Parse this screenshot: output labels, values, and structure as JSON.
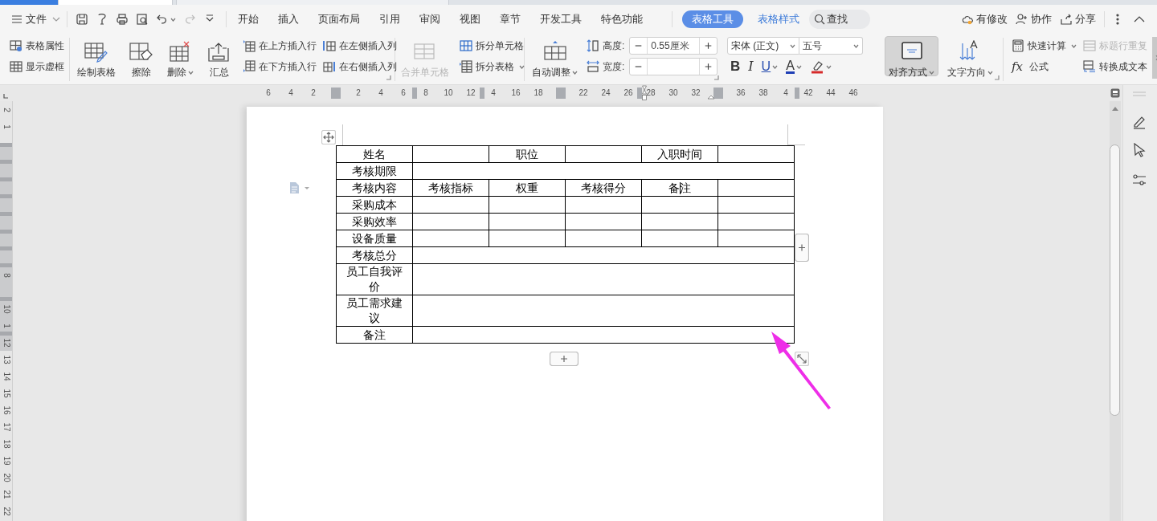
{
  "menu": {
    "file": "文件",
    "tabs": [
      {
        "label": "开始",
        "kind": "main",
        "selected": false
      },
      {
        "label": "插入",
        "kind": "main",
        "selected": false
      },
      {
        "label": "页面布局",
        "kind": "main",
        "selected": false
      },
      {
        "label": "引用",
        "kind": "main",
        "selected": false
      },
      {
        "label": "审阅",
        "kind": "main",
        "selected": false
      },
      {
        "label": "视图",
        "kind": "main",
        "selected": false
      },
      {
        "label": "章节",
        "kind": "main",
        "selected": false
      },
      {
        "label": "开发工具",
        "kind": "main",
        "selected": false
      },
      {
        "label": "特色功能",
        "kind": "main",
        "selected": false
      },
      {
        "label": "表格工具",
        "kind": "context",
        "selected": true
      },
      {
        "label": "表格样式",
        "kind": "context",
        "selected": false
      }
    ],
    "search": "查找",
    "actions": [
      "有修改",
      "协作",
      "分享"
    ]
  },
  "ribbon": {
    "groups": [
      {
        "items": [
          {
            "kind": "stack",
            "items": [
              {
                "label": "表格属性"
              },
              {
                "label": "显示虚框"
              }
            ]
          }
        ]
      },
      {
        "launcher": true,
        "items": [
          {
            "kind": "large",
            "label": "绘制表格"
          },
          {
            "kind": "large",
            "label": "擦除"
          },
          {
            "kind": "large",
            "label": "删除",
            "dropdown": true
          },
          {
            "kind": "large",
            "label": "汇总"
          },
          {
            "kind": "stack",
            "items": [
              {
                "label": "在上方插入行"
              },
              {
                "label": "在下方插入行"
              }
            ]
          },
          {
            "kind": "stack",
            "items": [
              {
                "label": "在左侧插入列"
              },
              {
                "label": "在右侧插入列"
              }
            ]
          }
        ]
      },
      {
        "items": [
          {
            "kind": "large",
            "label": "合并单元格",
            "disabled": true
          },
          {
            "kind": "stack",
            "items": [
              {
                "label": "拆分单元格"
              },
              {
                "label": "拆分表格",
                "dropdown": true
              }
            ]
          }
        ]
      },
      {
        "launcher": true,
        "items": [
          {
            "kind": "large",
            "label": "自动调整",
            "dropdown": true
          },
          {
            "kind": "spins",
            "items": [
              {
                "label": "高度:",
                "value": "0.55厘米"
              },
              {
                "label": "宽度:"
              }
            ]
          }
        ]
      },
      {
        "items": [
          {
            "kind": "font",
            "font": "宋体 (正文)",
            "size": "五号",
            "buttons": [
              {
                "label": "B"
              },
              {
                "label": "I"
              },
              {
                "label": "U",
                "dropdown": true
              },
              {
                "label": "A",
                "dropdown": true
              },
              {
                "dropdown": true
              }
            ]
          }
        ]
      },
      {
        "launcher": true,
        "items": [
          {
            "kind": "large",
            "label": "对齐方式",
            "dropdown": true,
            "selected": true
          },
          {
            "kind": "large",
            "label": "文字方向",
            "dropdown": true,
            "selected": false
          }
        ]
      },
      {
        "items": [
          {
            "kind": "stack",
            "items": [
              {
                "label": "快速计算",
                "dropdown": true
              },
              {
                "label": "公式",
                "symbol": "fx"
              }
            ]
          },
          {
            "kind": "stack",
            "items": [
              {
                "label": "标题行重复",
                "disabled": true
              },
              {
                "label": "转换成文本"
              }
            ]
          }
        ]
      }
    ]
  },
  "ruler": {
    "horizontal": [
      {
        "kind": "num",
        "label": "6"
      },
      {
        "kind": "num",
        "label": "4"
      },
      {
        "kind": "num",
        "label": "2"
      },
      {
        "kind": "slot_marker"
      },
      {
        "kind": "num",
        "label": "2"
      },
      {
        "kind": "num",
        "label": "4"
      },
      {
        "kind": "num",
        "label": "6"
      },
      {
        "kind": "marker"
      },
      {
        "kind": "num",
        "label": "8"
      },
      {
        "kind": "num",
        "label": "10"
      },
      {
        "kind": "num",
        "label": "12"
      },
      {
        "kind": "marker"
      },
      {
        "kind": "num",
        "label": "4"
      },
      {
        "kind": "num",
        "label": "16"
      },
      {
        "kind": "num",
        "label": "18"
      },
      {
        "kind": "slot_marker"
      },
      {
        "kind": "num",
        "label": "22"
      },
      {
        "kind": "num",
        "label": "24"
      },
      {
        "kind": "num",
        "label": "26"
      },
      {
        "kind": "marker"
      },
      {
        "kind": "num",
        "label": "28"
      },
      {
        "kind": "num",
        "label": "30"
      },
      {
        "kind": "num",
        "label": "32"
      },
      {
        "kind": "slot_marker"
      },
      {
        "kind": "num",
        "label": "36"
      },
      {
        "kind": "num",
        "label": "38"
      },
      {
        "kind": "num",
        "label": "4"
      },
      {
        "kind": "marker"
      },
      {
        "kind": "num",
        "label": "42"
      },
      {
        "kind": "num",
        "label": "44"
      },
      {
        "kind": "num",
        "label": "46"
      }
    ],
    "vertical": {
      "upper": [
        "2",
        "1"
      ],
      "middle": [
        "8"
      ],
      "lower": [
        "10",
        "1",
        "12",
        "13",
        "14",
        "15",
        "16",
        "17",
        "18",
        "19",
        "20",
        "21",
        "22"
      ]
    }
  },
  "table": {
    "rows": [
      {
        "cells": [
          {
            "text": "姓名"
          },
          {},
          {
            "text": "职位"
          },
          {},
          {
            "text": "入职时间"
          },
          {}
        ]
      },
      {
        "cells": [
          {
            "text": "考核期限"
          },
          {
            "colspan": 5
          }
        ]
      },
      {
        "cells": [
          {
            "text": "考核内容"
          },
          {
            "text": "考核指标"
          },
          {
            "text": "权重"
          },
          {
            "text": "考核得分"
          },
          {
            "text": "备注",
            "caret": true
          },
          {}
        ]
      },
      {
        "cells": [
          {
            "text": "采购成本"
          },
          {},
          {},
          {},
          {},
          {}
        ]
      },
      {
        "cells": [
          {
            "text": "采购效率"
          },
          {},
          {},
          {},
          {},
          {}
        ]
      },
      {
        "cells": [
          {
            "text": "设备质量"
          },
          {},
          {},
          {},
          {},
          {}
        ]
      },
      {
        "cells": [
          {
            "text": "考核总分"
          },
          {
            "colspan": 5
          }
        ]
      },
      {
        "cells": [
          {
            "text": "员工自我评价"
          },
          {
            "colspan": 5
          }
        ]
      },
      {
        "cells": [
          {
            "text": "员工需求建议"
          },
          {
            "colspan": 5
          }
        ]
      },
      {
        "cells": [
          {
            "text": "备注"
          },
          {
            "colspan": 5
          }
        ]
      }
    ]
  }
}
